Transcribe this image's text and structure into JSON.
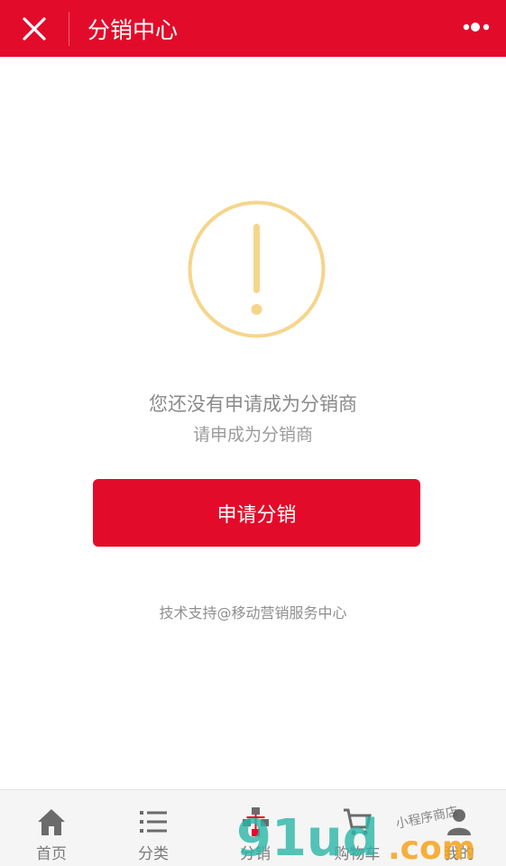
{
  "header": {
    "title": "分销中心",
    "close_icon": "close-icon",
    "more_icon": "more-dots-icon",
    "bg_color": "#e30b2a"
  },
  "notice": {
    "icon": "exclamation-circle-icon",
    "icon_color": "#f6d58b",
    "message": "您还没有申请成为分销商",
    "sub_message": "请申成为分销商"
  },
  "apply_button": {
    "label": "申请分销"
  },
  "footer": {
    "support_text": "技术支持@移动营销服务中心"
  },
  "tabbar": {
    "items": [
      {
        "label": "首页",
        "icon": "home-icon"
      },
      {
        "label": "分类",
        "icon": "list-icon"
      },
      {
        "label": "分销",
        "icon": "distribution-icon"
      },
      {
        "label": "购物车",
        "icon": "cart-icon"
      },
      {
        "label": "我的",
        "icon": "user-icon"
      }
    ]
  },
  "watermark": {
    "text_main": "91ud",
    "text_suffix": ".com",
    "text_small": "小程序商店"
  }
}
